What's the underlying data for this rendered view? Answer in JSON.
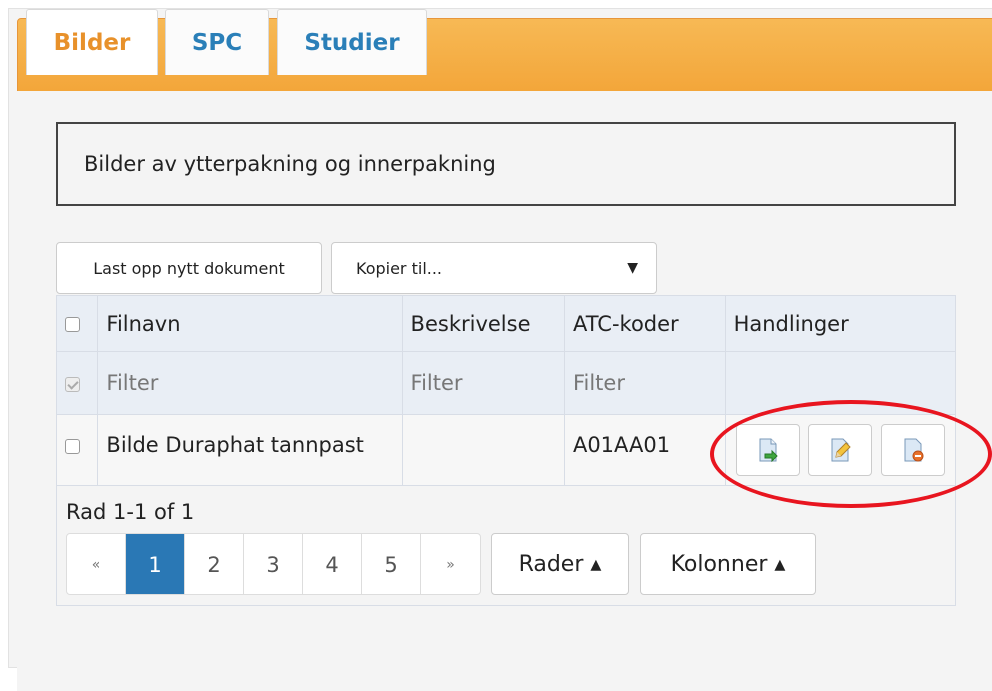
{
  "tabs": [
    {
      "label": "Bilder",
      "active": true
    },
    {
      "label": "SPC",
      "active": false
    },
    {
      "label": "Studier",
      "active": false
    }
  ],
  "heading": "Bilder av ytterpakning og innerpakning",
  "toolbar": {
    "upload_label": "Last opp nytt dokument",
    "copy_label": "Kopier til...",
    "copy_caret": "▼"
  },
  "table": {
    "columns": [
      "Filnavn",
      "Beskrivelse",
      "ATC-koder",
      "Handlinger"
    ],
    "filters": [
      "Filter",
      "Filter",
      "Filter"
    ],
    "rows": [
      {
        "filnavn": "Bilde Duraphat tannpast",
        "beskrivelse": "",
        "atc": "A01AA01"
      }
    ]
  },
  "pagination": {
    "row_info": "Rad 1-1 of 1",
    "first": "«",
    "pages": [
      "1",
      "2",
      "3",
      "4",
      "5"
    ],
    "active_page": "1",
    "last": "»"
  },
  "rows_button": "Rader ▴",
  "columns_button": "Kolonner ▴",
  "colors": {
    "tab_bar": "#f3a63a",
    "active_tab_text": "#e8912a",
    "inactive_tab_text": "#2a7fb8",
    "active_page": "#2a78b5",
    "highlight_ellipse": "#e8151f"
  }
}
